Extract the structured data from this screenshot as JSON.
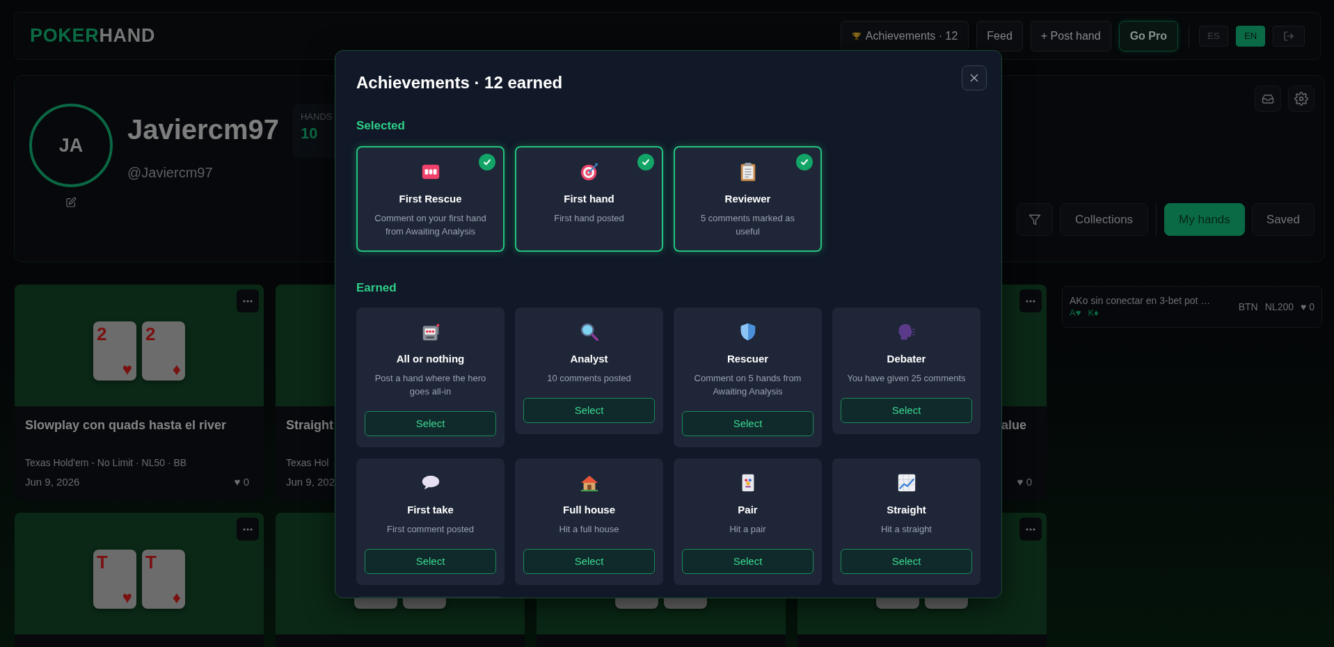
{
  "header": {
    "logo_primary": "POKER",
    "logo_secondary": "HAND",
    "nav": [
      {
        "label": "Achievements · 12",
        "kind": "achievements"
      },
      {
        "label": "Feed",
        "kind": "plain"
      },
      {
        "label": "+ Post hand",
        "kind": "plain"
      },
      {
        "label": "Go Pro",
        "kind": "pro"
      }
    ],
    "languages": [
      {
        "label": "ES",
        "selected": false
      },
      {
        "label": "EN",
        "selected": true
      }
    ]
  },
  "profile": {
    "initials": "JA",
    "name": "Javiercm97",
    "handle": "@Javiercm97",
    "stats": [
      {
        "label": "HANDS",
        "value": "10"
      }
    ],
    "collections_button": "Collections",
    "tabs": [
      {
        "label": "My hands",
        "selected": true
      },
      {
        "label": "Saved",
        "selected": false
      }
    ]
  },
  "hands": [
    {
      "kind": "open",
      "title": "Slowplay con quads hasta el river",
      "meta": "Texas Hold'em - No Limit · NL50 · BB",
      "date": "Jun 9, 2026",
      "likes": "♥ 0",
      "cards": [
        {
          "rank": "2",
          "suit": "♥"
        },
        {
          "rank": "2",
          "suit": "♦"
        }
      ]
    },
    {
      "kind": "covered",
      "title": "Straight",
      "meta": "Texas Hol",
      "date": "Jun 9, 202"
    },
    {
      "kind": "tail",
      "title": "alue",
      "likes": "♥ 0"
    },
    {
      "kind": "open",
      "cards": [
        {
          "rank": "T",
          "suit": "♥"
        },
        {
          "rank": "T",
          "suit": "♦"
        }
      ]
    },
    {
      "kind": "stub"
    },
    {
      "kind": "stub"
    },
    {
      "kind": "stub_menu"
    }
  ],
  "recent": [
    {
      "title": "AKo sin conectar en 3-bet pot …",
      "cards": [
        "A♥",
        "K♦"
      ],
      "position": "BTN",
      "stake": "NL200",
      "likes": "♥ 0"
    }
  ],
  "modal": {
    "title": "Achievements · 12 earned",
    "sections": [
      {
        "heading": "Selected",
        "items": [
          {
            "title": "First Rescue",
            "description": "Comment on your first hand from Awaiting Analysis",
            "selected": true
          },
          {
            "title": "First hand",
            "description": "First hand posted",
            "selected": true
          },
          {
            "title": "Reviewer",
            "description": "5 comments marked as useful",
            "selected": true
          }
        ]
      },
      {
        "heading": "Earned",
        "items": [
          {
            "title": "All or nothing",
            "description": "Post a hand where the hero goes all-in",
            "selected": false,
            "action": "Select"
          },
          {
            "title": "Analyst",
            "description": "10 comments posted",
            "selected": false,
            "action": "Select"
          },
          {
            "title": "Rescuer",
            "description": "Comment on 5 hands from Awaiting Analysis",
            "selected": false,
            "action": "Select"
          },
          {
            "title": "Debater",
            "description": "You have given 25 comments",
            "selected": false,
            "action": "Select"
          },
          {
            "title": "First take",
            "description": "First comment posted",
            "selected": false,
            "action": "Select"
          },
          {
            "title": "Full house",
            "description": "Hit a full house",
            "selected": false,
            "action": "Select"
          },
          {
            "title": "Pair",
            "description": "Hit a pair",
            "selected": false,
            "action": "Select"
          },
          {
            "title": "Straight",
            "description": "Hit a straight",
            "selected": false,
            "action": "Select"
          },
          {
            "selected": false
          }
        ]
      }
    ]
  }
}
